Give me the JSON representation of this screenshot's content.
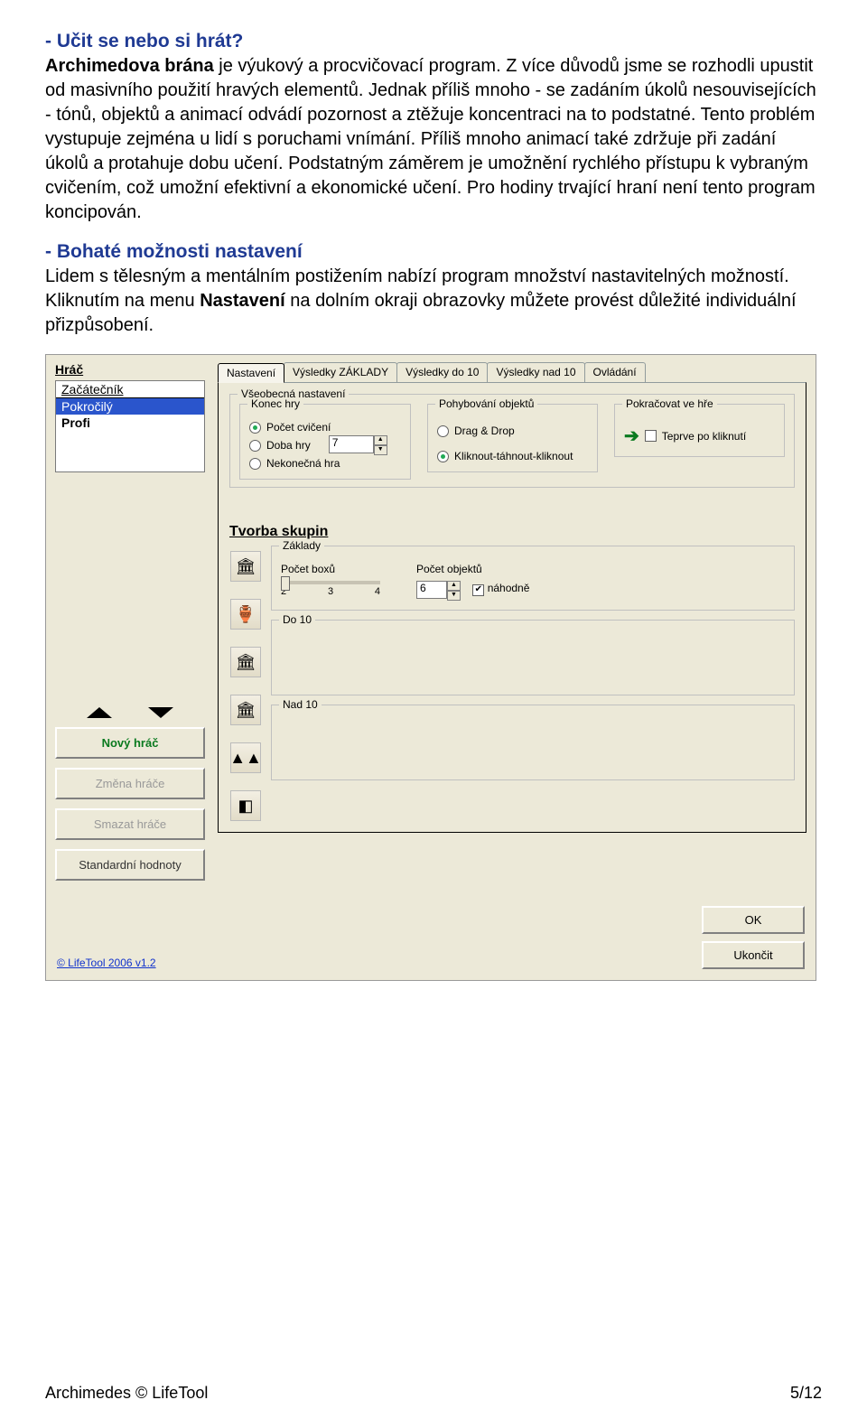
{
  "doc": {
    "heading1": "- Učit se nebo si hrát?",
    "para1_prefix": "Archimedova brána",
    "para1_rest": "  je výukový a procvičovací program. Z více důvodů jsme se rozhodli upustit od masivního použití hravých elementů. Jednak příliš mnoho - se zadáním úkolů nesouvisejících - tónů, objektů a animací odvádí pozornost a ztěžuje koncentraci na to podstatné. Tento problém vystupuje zejména u lidí s poruchami vnímání. Příliš mnoho animací také zdržuje při zadání úkolů a protahuje dobu učení. Podstatným záměrem je umožnění rychlého přístupu k vybraným cvičením, což umožní efektivní a ekonomické učení. Pro hodiny trvající hraní není tento program koncipován.",
    "heading2": "- Bohaté možnosti nastavení",
    "para2_a": "Lidem s tělesným a mentálním postižením nabízí program množství nastavitelných možností. Kliknutím na menu ",
    "para2_bold": "Nastavení",
    "para2_b": " na dolním okraji obrazovky můžete provést důležité individuální přizpůsobení."
  },
  "ui": {
    "left": {
      "label": "Hráč",
      "players": [
        "Začátečník",
        "Pokročilý",
        "Profi"
      ],
      "selected_index": 1,
      "buttons": {
        "new": "Nový hráč",
        "change": "Změna hráče",
        "delete": "Smazat hráče",
        "defaults": "Standardní hodnoty"
      }
    },
    "tabs": [
      "Nastavení",
      "Výsledky ZÁKLADY",
      "Výsledky do 10",
      "Výsledky nad 10",
      "Ovládání"
    ],
    "active_tab": 0,
    "general": {
      "legend": "Všeobecná nastavení",
      "endgame_legend": "Konec hry",
      "opt_count": "Počet cvičení",
      "opt_time": "Doba hry",
      "opt_endless": "Nekonečná hra",
      "count_value": "7",
      "move_legend": "Pohybování objektů",
      "move_opt1": "Drag & Drop",
      "move_opt2": "Kliknout-táhnout-kliknout",
      "cont_legend": "Pokračovat ve hře",
      "cont_opt": "Teprve po kliknutí"
    },
    "groups": {
      "title": "Tvorba skupin",
      "basics_legend": "Základy",
      "boxes_legend": "Počet boxů",
      "ticks": [
        "2",
        "3",
        "4"
      ],
      "objects_legend": "Počet objektů",
      "objects_value": "6",
      "random_label": "náhodně",
      "do10_legend": "Do 10",
      "nad10_legend": "Nad 10"
    },
    "footer": {
      "link": "© LifeTool 2006 v1.2",
      "ok": "OK",
      "exit": "Ukončit"
    }
  },
  "page_footer": {
    "left": "Archimedes © LifeTool",
    "right": "5/12"
  }
}
